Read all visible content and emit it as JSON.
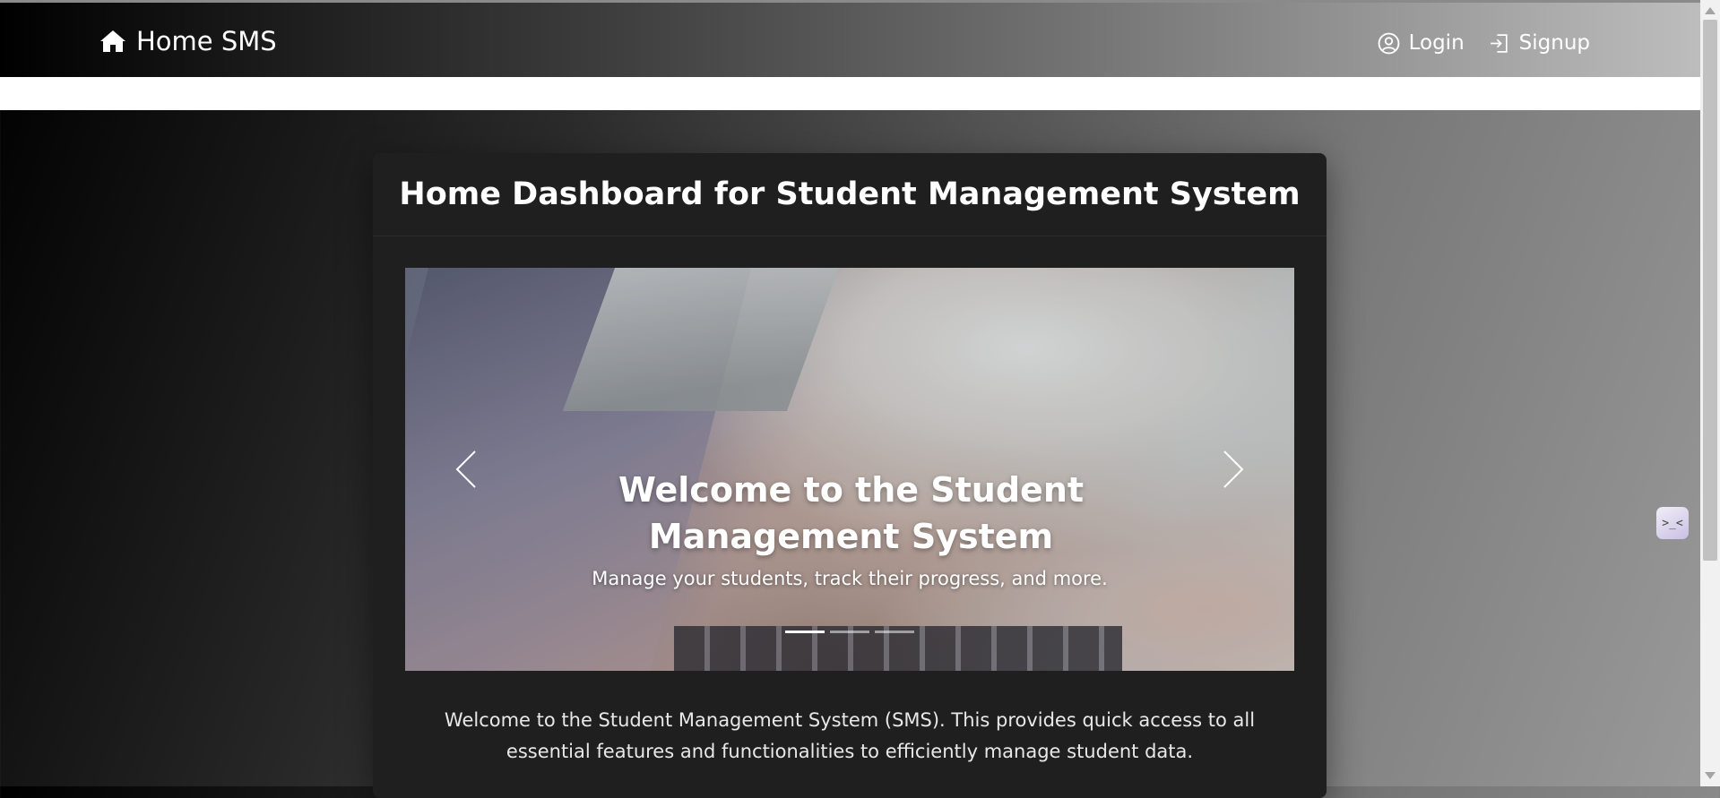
{
  "navbar": {
    "brand_label": "Home SMS",
    "brand_icon": "home-icon",
    "login_label": "Login",
    "login_icon": "user-circle-icon",
    "signup_label": "Signup",
    "signup_icon": "sign-in-icon"
  },
  "dashboard": {
    "title": "Home Dashboard for Student Management System",
    "carousel": {
      "slide_title": "Welcome to the Student Management System",
      "slide_text": "Manage your students, track their progress, and more.",
      "indicator_count": 3,
      "active_indicator": 1,
      "prev_icon": "chevron-left-icon",
      "next_icon": "chevron-right-icon"
    },
    "description": "Welcome to the Student Management System (SMS). This provides quick access to all essential features and functionalities to efficiently manage student data."
  },
  "side_widget": {
    "label": ">_<"
  },
  "colors": {
    "card_bg": "#1f1f1f",
    "navbar_dark": "#000000",
    "navbar_light": "#bdbdbd",
    "text": "#ffffff"
  }
}
